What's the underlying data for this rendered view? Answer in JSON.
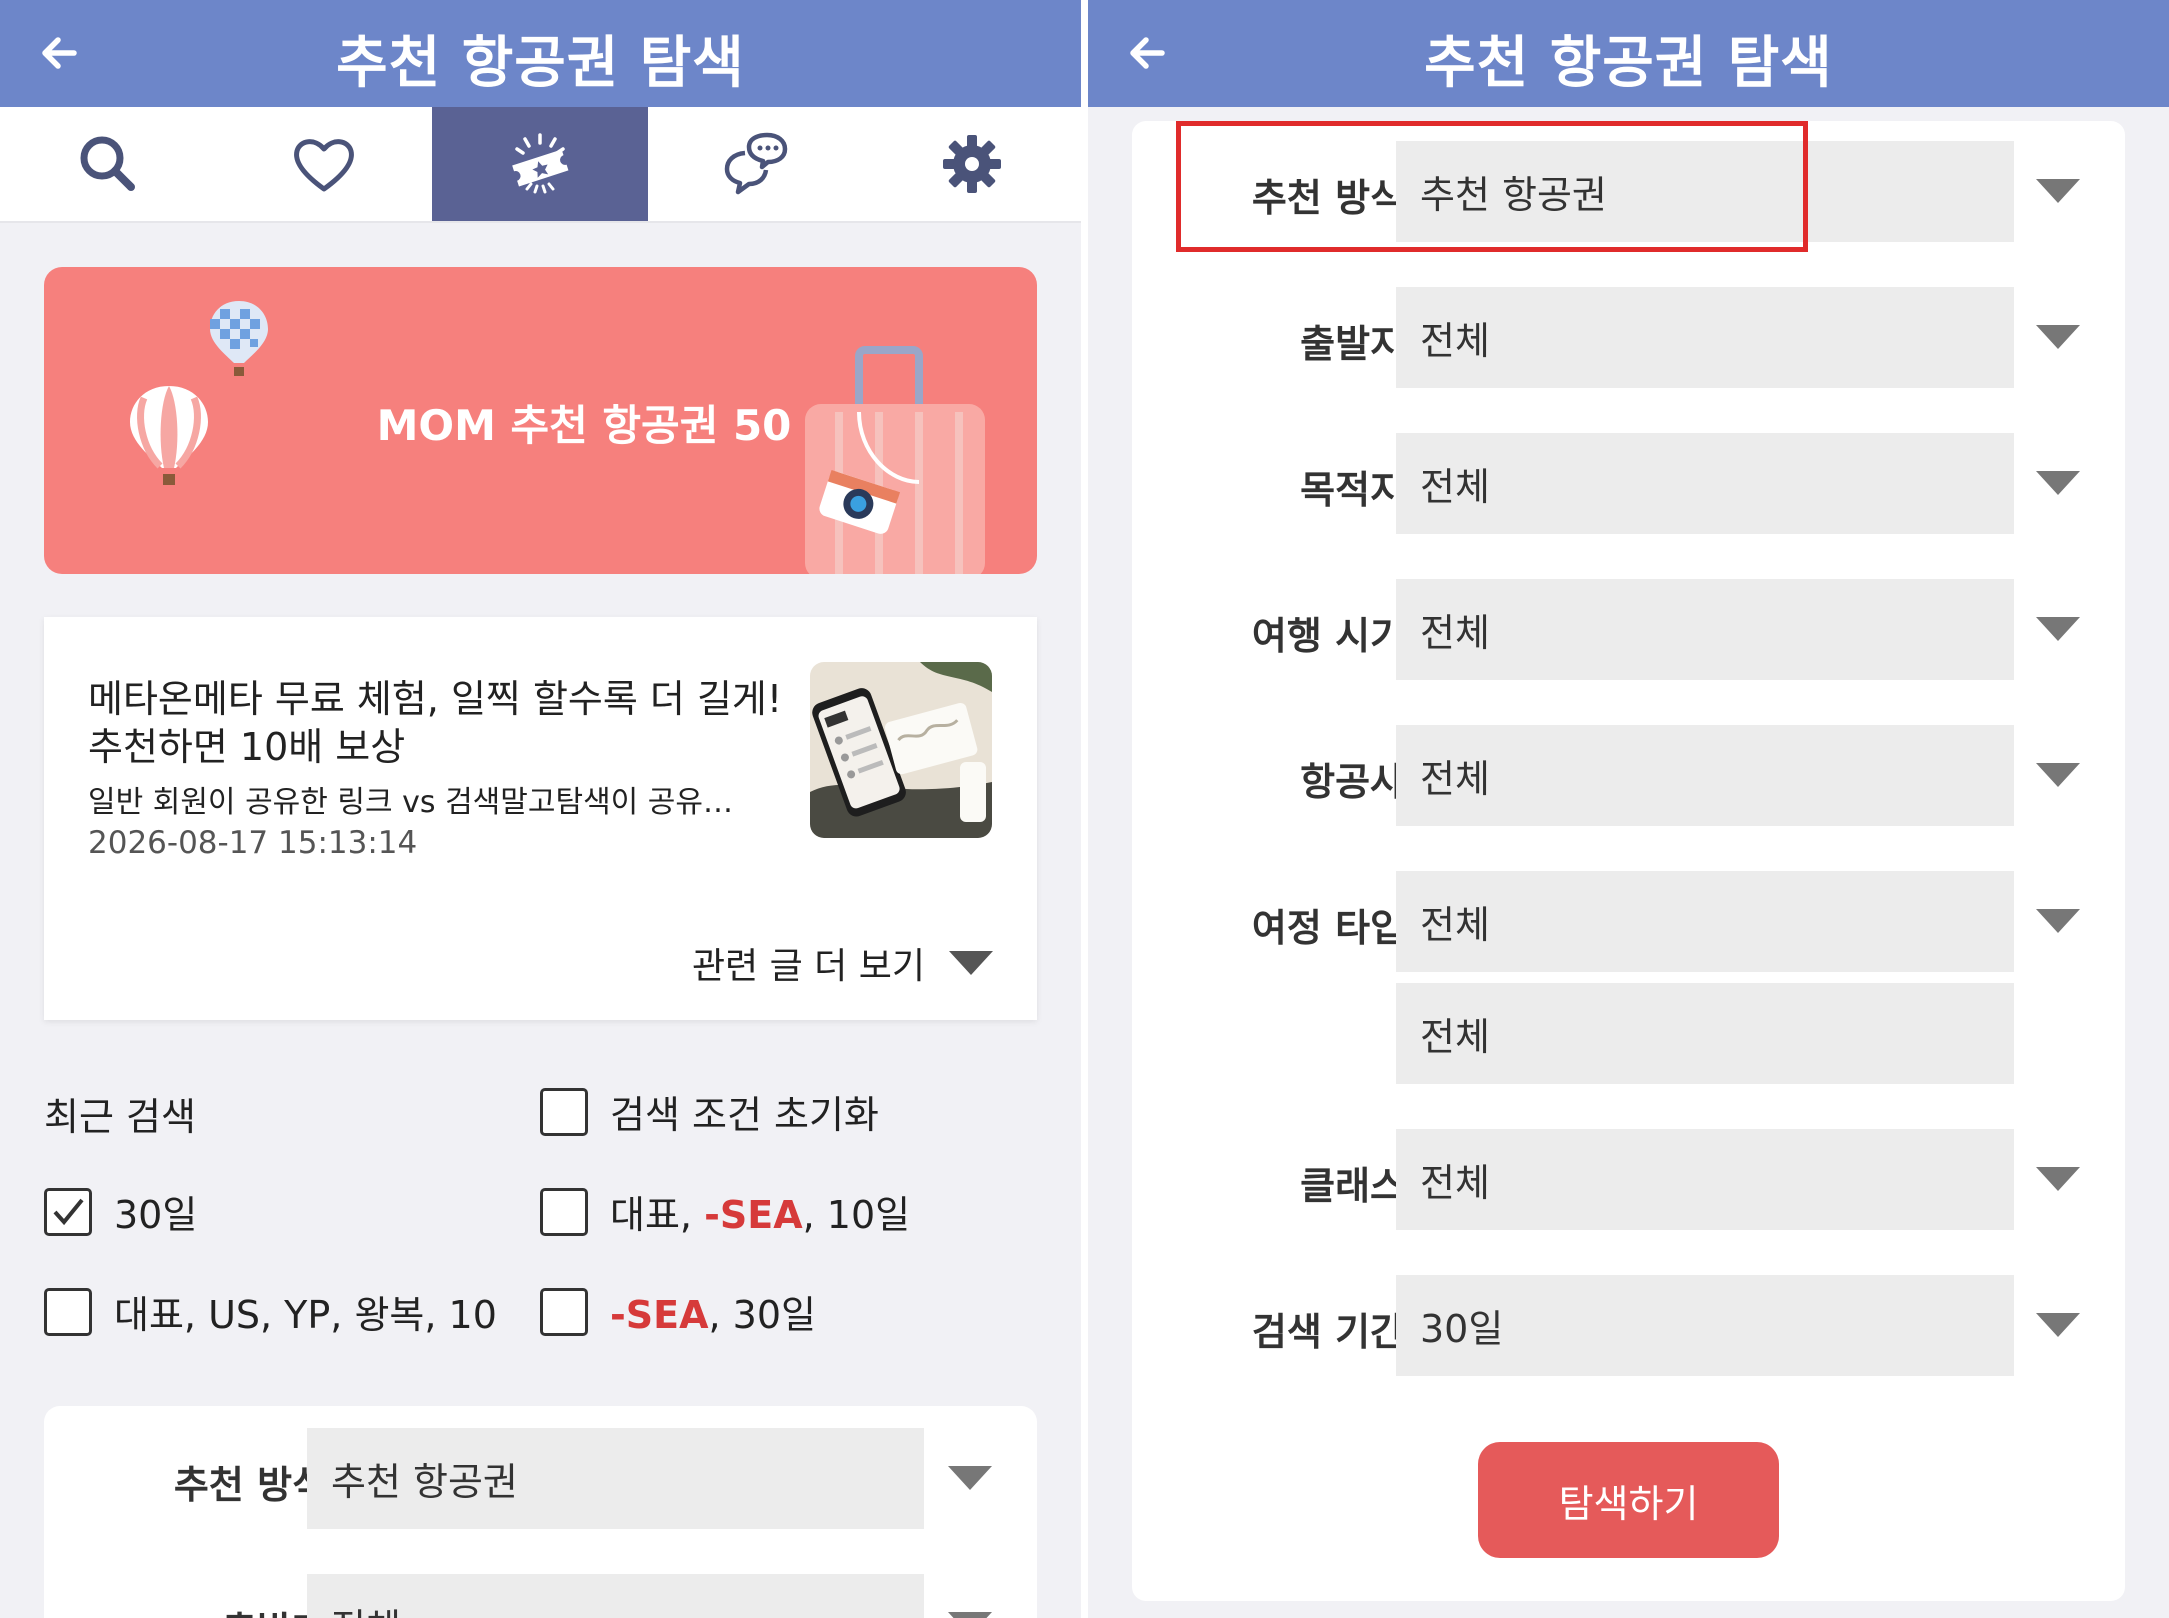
{
  "left": {
    "header": {
      "title": "추천 항공권 탐색"
    },
    "tabs": [
      {
        "icon": "search-icon"
      },
      {
        "icon": "heart-icon"
      },
      {
        "icon": "ticket-icon",
        "active": true
      },
      {
        "icon": "chat-icon"
      },
      {
        "icon": "gear-icon"
      }
    ],
    "banner": {
      "title": "MOM 추천 항공권 50"
    },
    "article": {
      "title": "메타온메타 무료 체험, 일찍 할수록 더 길게! 추천하면 10배 보상",
      "subtitle": "일반 회원이 공유한 링크 vs 검색말고탐색이 공유…",
      "date": "2026-08-17 15:13:14",
      "more_label": "관련 글 더 보기"
    },
    "recent": {
      "label": "최근 검색",
      "reset_label": "검색 조건 초기화",
      "items": [
        {
          "text": "30일",
          "checked": true
        },
        {
          "prefix": "대표, ",
          "highlight": "-SEA",
          "suffix": ", 10일",
          "checked": false
        },
        {
          "text": "대표, US, YP, 왕복, 10",
          "checked": false
        },
        {
          "prefix": "",
          "highlight": "-SEA",
          "suffix": ", 30일",
          "checked": false
        }
      ]
    },
    "form": [
      {
        "label": "추천 방식",
        "value": "추천 항공권"
      },
      {
        "label": "출발지",
        "value": "전체"
      }
    ]
  },
  "right": {
    "header": {
      "title": "추천 항공권 탐색"
    },
    "form": [
      {
        "label": "추천 방식",
        "value": "추천 항공권"
      },
      {
        "label": "출발지",
        "value": "전체"
      },
      {
        "label": "목적지",
        "value": "전체"
      },
      {
        "label": "여행 시기",
        "value": "전체"
      },
      {
        "label": "항공사",
        "value": "전체"
      },
      {
        "label": "여정 타입",
        "value": "전체"
      },
      {
        "label": "",
        "value": "전체"
      },
      {
        "label": "클래스",
        "value": "전체"
      },
      {
        "label": "검색 기간",
        "value": "30일"
      }
    ],
    "search_button": "탐색하기"
  },
  "colors": {
    "header": "#6d86c9",
    "active_tab": "#5a6294",
    "banner": "#f6807d",
    "highlight": "#e02b2b",
    "search_button": "#e55a5a",
    "sea_text": "#d63a3a"
  }
}
